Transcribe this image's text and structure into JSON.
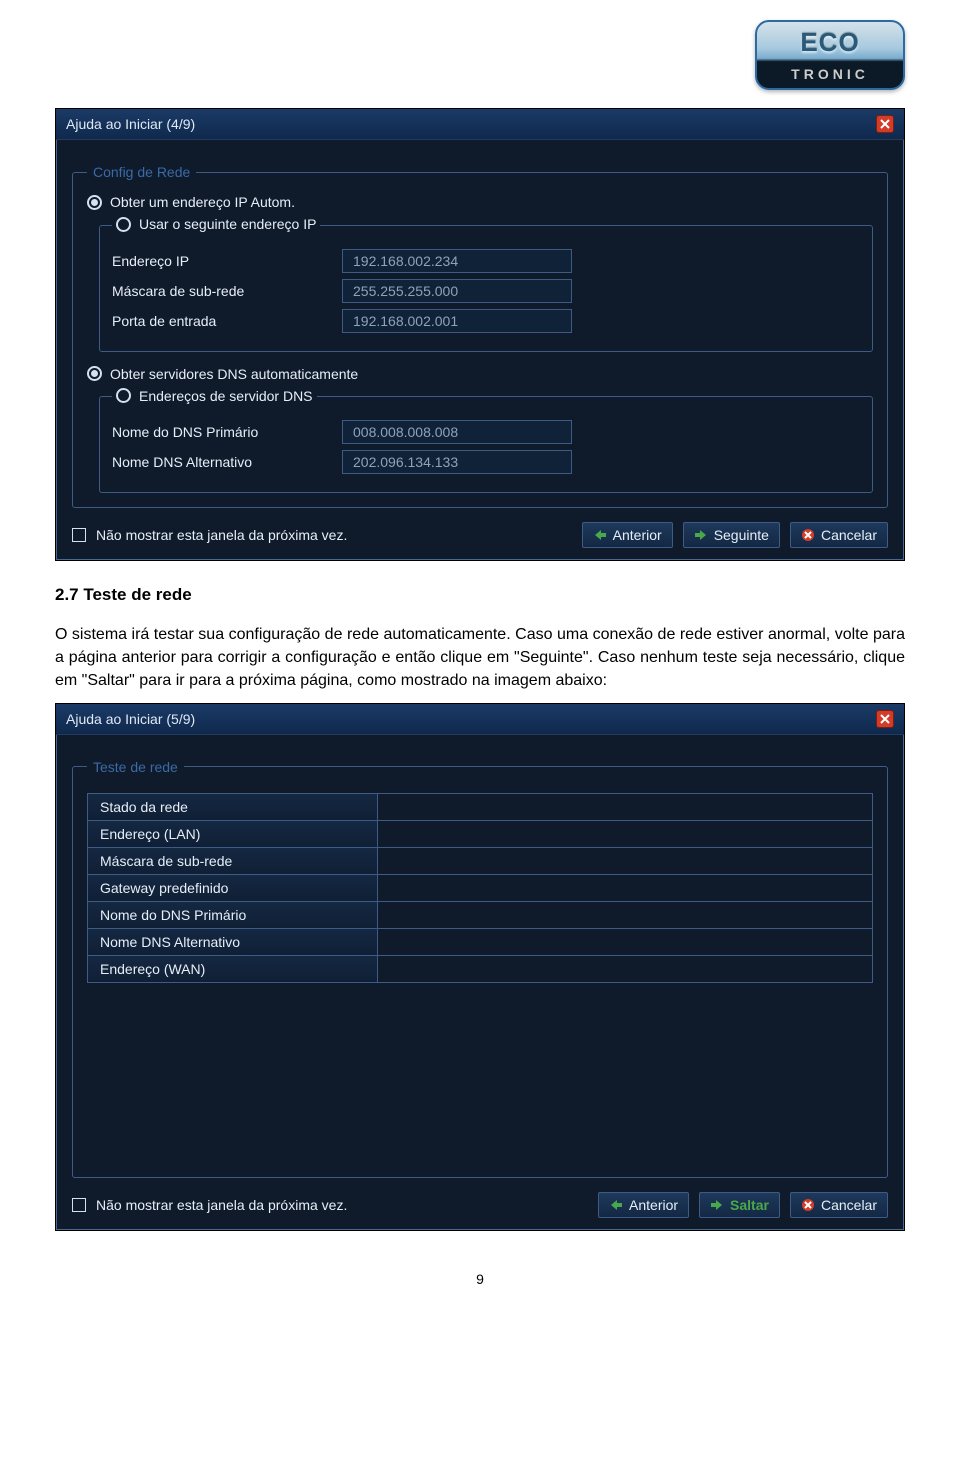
{
  "logo": {
    "top": "ECO",
    "bottom": "TRONIC"
  },
  "dialog1": {
    "title": "Ajuda ao Iniciar (4/9)",
    "fieldset_title": "Config de Rede",
    "radio_auto_ip": "Obter um endereço IP Autom.",
    "radio_manual_ip": "Usar o seguinte endereço IP",
    "ip_label": "Endereço IP",
    "ip_value": "192.168.002.234",
    "mask_label": "Máscara de sub-rede",
    "mask_value": "255.255.255.000",
    "gateway_label": "Porta de entrada",
    "gateway_value": "192.168.002.001",
    "radio_auto_dns": "Obter servidores DNS automaticamente",
    "radio_manual_dns": "Endereços de servidor DNS",
    "dns1_label": "Nome do DNS Primário",
    "dns1_value": "008.008.008.008",
    "dns2_label": "Nome DNS Alternativo",
    "dns2_value": "202.096.134.133",
    "dont_show": "Não mostrar esta janela da próxima vez.",
    "prev": "Anterior",
    "next": "Seguinte",
    "cancel": "Cancelar"
  },
  "section_heading": "2.7 Teste de rede",
  "para1": "O sistema irá testar sua configuração de rede automaticamente. Caso uma conexão de rede estiver anormal, volte para a página anterior para corrigir a configuração e então clique em \"Seguinte\". Caso nenhum teste seja necessário, clique em \"Saltar\" para ir para a próxima página, como mostrado na imagem abaixo:",
  "dialog2": {
    "title": "Ajuda ao Iniciar (5/9)",
    "fieldset_title": "Teste de rede",
    "rows": [
      "Stado da rede",
      "Endereço (LAN)",
      "Máscara de sub-rede",
      "Gateway predefinido",
      "Nome do DNS Primário",
      "Nome DNS Alternativo",
      "Endereço (WAN)"
    ],
    "dont_show": "Não mostrar esta janela da próxima vez.",
    "prev": "Anterior",
    "skip": "Saltar",
    "cancel": "Cancelar"
  },
  "page_number": "9"
}
